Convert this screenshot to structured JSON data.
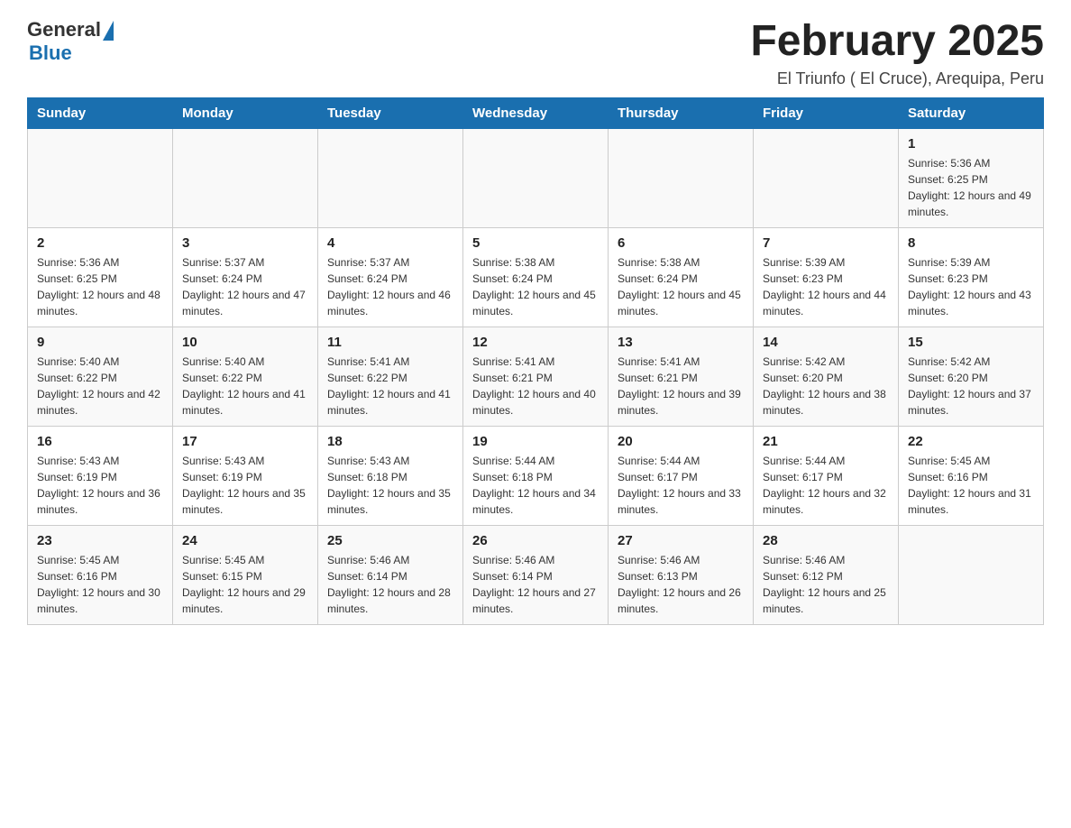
{
  "logo": {
    "general": "General",
    "blue": "Blue"
  },
  "title": "February 2025",
  "subtitle": "El Triunfo ( El Cruce), Arequipa, Peru",
  "days_of_week": [
    "Sunday",
    "Monday",
    "Tuesday",
    "Wednesday",
    "Thursday",
    "Friday",
    "Saturday"
  ],
  "weeks": [
    [
      {
        "day": "",
        "info": ""
      },
      {
        "day": "",
        "info": ""
      },
      {
        "day": "",
        "info": ""
      },
      {
        "day": "",
        "info": ""
      },
      {
        "day": "",
        "info": ""
      },
      {
        "day": "",
        "info": ""
      },
      {
        "day": "1",
        "info": "Sunrise: 5:36 AM\nSunset: 6:25 PM\nDaylight: 12 hours and 49 minutes."
      }
    ],
    [
      {
        "day": "2",
        "info": "Sunrise: 5:36 AM\nSunset: 6:25 PM\nDaylight: 12 hours and 48 minutes."
      },
      {
        "day": "3",
        "info": "Sunrise: 5:37 AM\nSunset: 6:24 PM\nDaylight: 12 hours and 47 minutes."
      },
      {
        "day": "4",
        "info": "Sunrise: 5:37 AM\nSunset: 6:24 PM\nDaylight: 12 hours and 46 minutes."
      },
      {
        "day": "5",
        "info": "Sunrise: 5:38 AM\nSunset: 6:24 PM\nDaylight: 12 hours and 45 minutes."
      },
      {
        "day": "6",
        "info": "Sunrise: 5:38 AM\nSunset: 6:24 PM\nDaylight: 12 hours and 45 minutes."
      },
      {
        "day": "7",
        "info": "Sunrise: 5:39 AM\nSunset: 6:23 PM\nDaylight: 12 hours and 44 minutes."
      },
      {
        "day": "8",
        "info": "Sunrise: 5:39 AM\nSunset: 6:23 PM\nDaylight: 12 hours and 43 minutes."
      }
    ],
    [
      {
        "day": "9",
        "info": "Sunrise: 5:40 AM\nSunset: 6:22 PM\nDaylight: 12 hours and 42 minutes."
      },
      {
        "day": "10",
        "info": "Sunrise: 5:40 AM\nSunset: 6:22 PM\nDaylight: 12 hours and 41 minutes."
      },
      {
        "day": "11",
        "info": "Sunrise: 5:41 AM\nSunset: 6:22 PM\nDaylight: 12 hours and 41 minutes."
      },
      {
        "day": "12",
        "info": "Sunrise: 5:41 AM\nSunset: 6:21 PM\nDaylight: 12 hours and 40 minutes."
      },
      {
        "day": "13",
        "info": "Sunrise: 5:41 AM\nSunset: 6:21 PM\nDaylight: 12 hours and 39 minutes."
      },
      {
        "day": "14",
        "info": "Sunrise: 5:42 AM\nSunset: 6:20 PM\nDaylight: 12 hours and 38 minutes."
      },
      {
        "day": "15",
        "info": "Sunrise: 5:42 AM\nSunset: 6:20 PM\nDaylight: 12 hours and 37 minutes."
      }
    ],
    [
      {
        "day": "16",
        "info": "Sunrise: 5:43 AM\nSunset: 6:19 PM\nDaylight: 12 hours and 36 minutes."
      },
      {
        "day": "17",
        "info": "Sunrise: 5:43 AM\nSunset: 6:19 PM\nDaylight: 12 hours and 35 minutes."
      },
      {
        "day": "18",
        "info": "Sunrise: 5:43 AM\nSunset: 6:18 PM\nDaylight: 12 hours and 35 minutes."
      },
      {
        "day": "19",
        "info": "Sunrise: 5:44 AM\nSunset: 6:18 PM\nDaylight: 12 hours and 34 minutes."
      },
      {
        "day": "20",
        "info": "Sunrise: 5:44 AM\nSunset: 6:17 PM\nDaylight: 12 hours and 33 minutes."
      },
      {
        "day": "21",
        "info": "Sunrise: 5:44 AM\nSunset: 6:17 PM\nDaylight: 12 hours and 32 minutes."
      },
      {
        "day": "22",
        "info": "Sunrise: 5:45 AM\nSunset: 6:16 PM\nDaylight: 12 hours and 31 minutes."
      }
    ],
    [
      {
        "day": "23",
        "info": "Sunrise: 5:45 AM\nSunset: 6:16 PM\nDaylight: 12 hours and 30 minutes."
      },
      {
        "day": "24",
        "info": "Sunrise: 5:45 AM\nSunset: 6:15 PM\nDaylight: 12 hours and 29 minutes."
      },
      {
        "day": "25",
        "info": "Sunrise: 5:46 AM\nSunset: 6:14 PM\nDaylight: 12 hours and 28 minutes."
      },
      {
        "day": "26",
        "info": "Sunrise: 5:46 AM\nSunset: 6:14 PM\nDaylight: 12 hours and 27 minutes."
      },
      {
        "day": "27",
        "info": "Sunrise: 5:46 AM\nSunset: 6:13 PM\nDaylight: 12 hours and 26 minutes."
      },
      {
        "day": "28",
        "info": "Sunrise: 5:46 AM\nSunset: 6:12 PM\nDaylight: 12 hours and 25 minutes."
      },
      {
        "day": "",
        "info": ""
      }
    ]
  ]
}
